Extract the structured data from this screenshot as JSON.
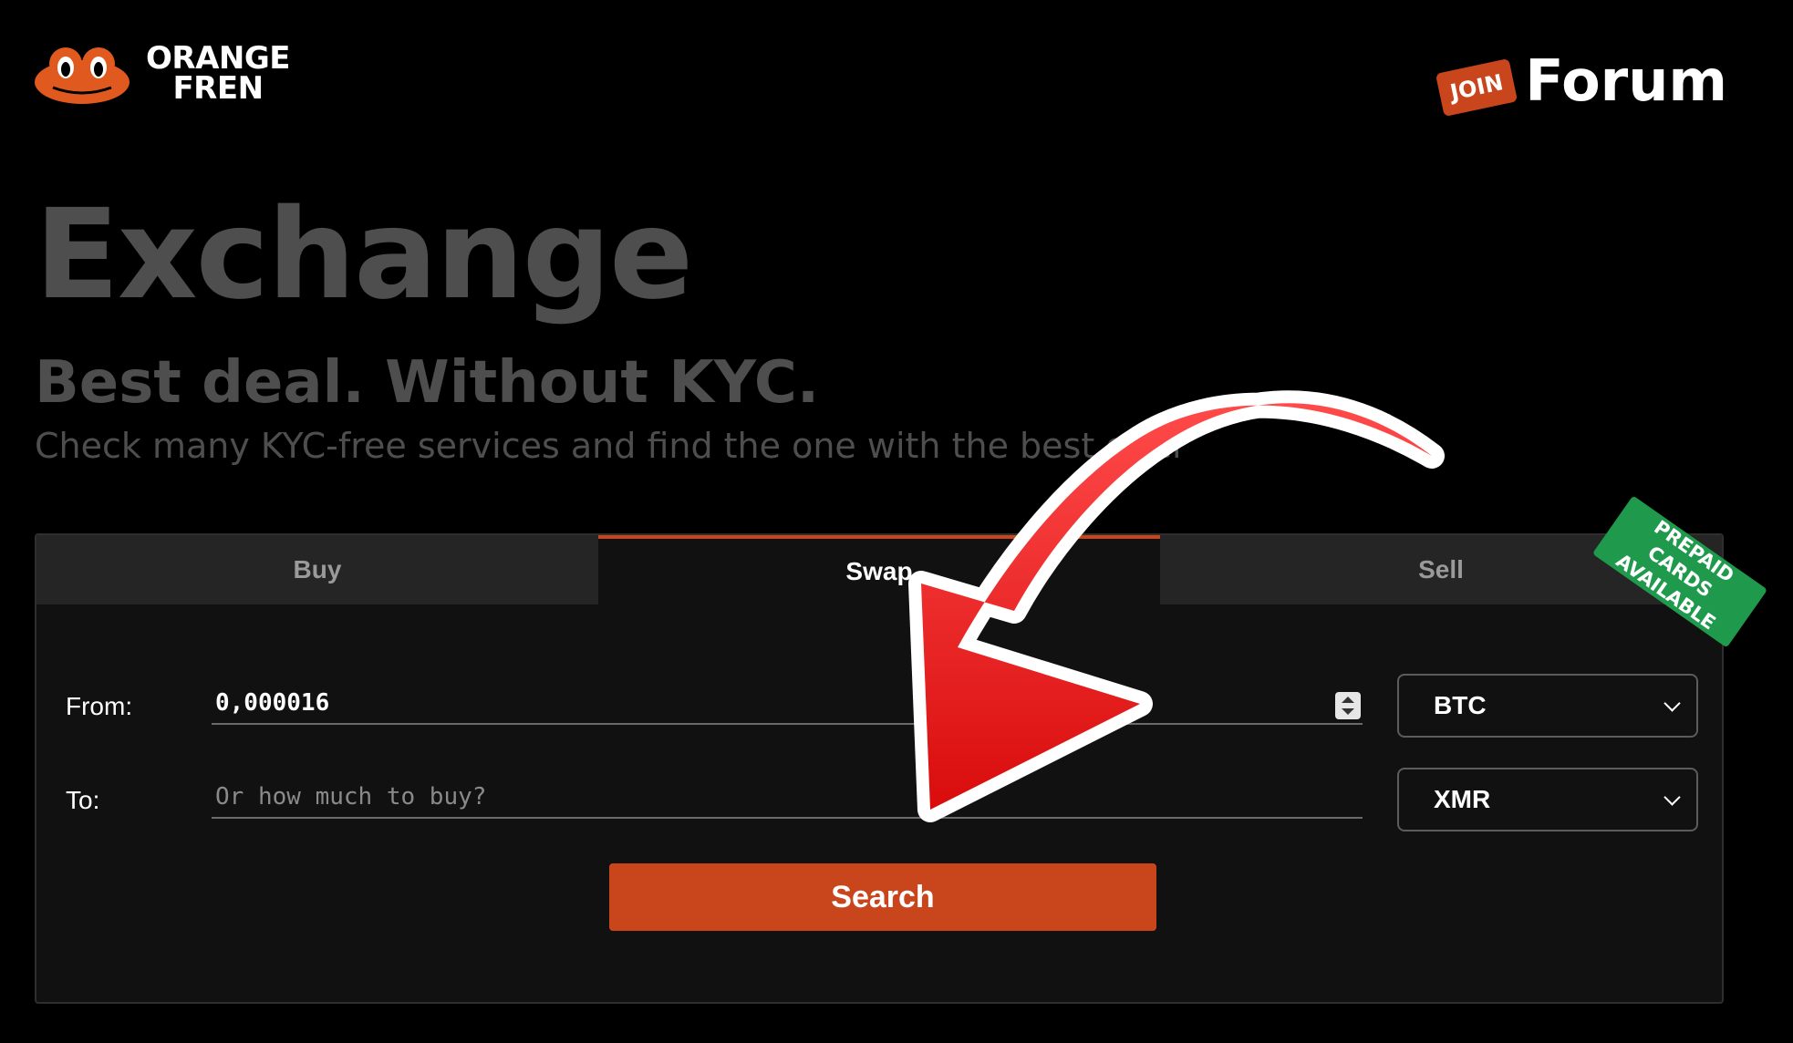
{
  "header": {
    "logo_line1": "ORANGE",
    "logo_line2": "FREN",
    "join_badge": "JOIN",
    "forum_label": "Forum"
  },
  "hero": {
    "title": "Exchange",
    "subtitle": "Best deal. Without KYC.",
    "description": "Check many KYC-free services and find the one with the best offer"
  },
  "tabs": [
    {
      "label": "Buy",
      "active": false
    },
    {
      "label": "Swap",
      "active": true
    },
    {
      "label": "Sell",
      "active": false
    }
  ],
  "badge": {
    "line1": "PREPAID CARDS",
    "line2": "AVAILABLE"
  },
  "form": {
    "from_label": "From:",
    "from_value": "0,000016",
    "from_currency": "BTC",
    "to_label": "To:",
    "to_placeholder": "Or how much to buy?",
    "to_value": "",
    "to_currency": "XMR",
    "search_label": "Search"
  },
  "colors": {
    "accent": "#c9461d",
    "badge_green": "#1f9a4c",
    "arrow_red": "#e3191b",
    "muted_text": "#4e4e4e"
  }
}
